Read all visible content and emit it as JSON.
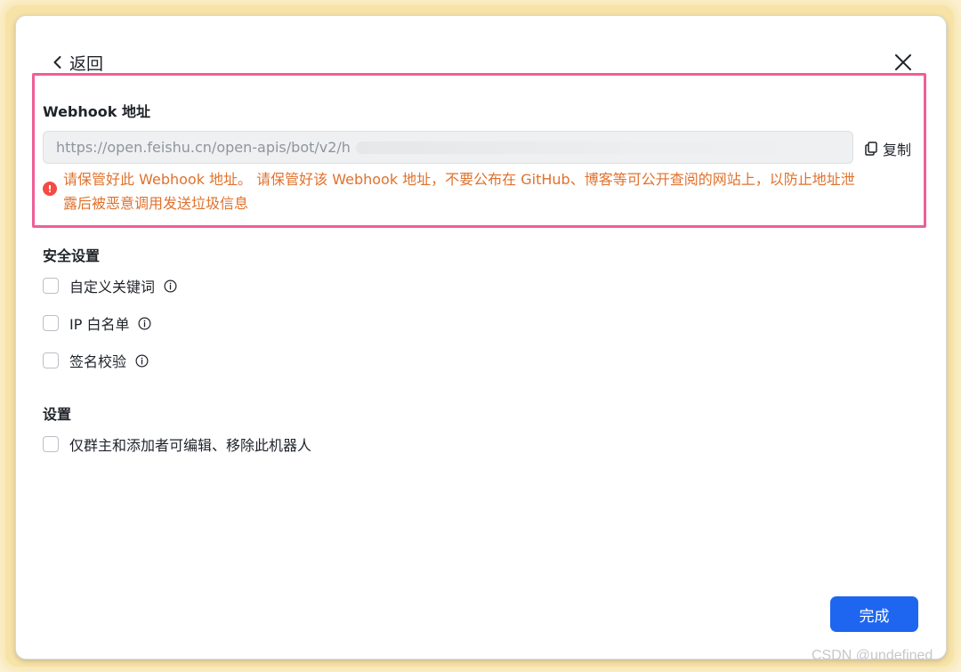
{
  "header": {
    "back_label": "返回"
  },
  "webhook": {
    "label": "Webhook 地址",
    "url_visible": "https://open.feishu.cn/open-apis/bot/v2/h",
    "copy_label": "复制",
    "warning_line1": "请保管好此 Webhook 地址。 请保管好该 Webhook 地址，不要公布在 GitHub、博客等可公开查阅的网站上，以防止地址泄",
    "warning_line2": "露后被恶意调用发送垃圾信息"
  },
  "security": {
    "title": "安全设置",
    "options": [
      {
        "label": "自定义关键词",
        "checked": false
      },
      {
        "label": "IP 白名单",
        "checked": false
      },
      {
        "label": "签名校验",
        "checked": false
      }
    ]
  },
  "settings": {
    "title": "设置",
    "options": [
      {
        "label": "仅群主和添加者可编辑、移除此机器人",
        "checked": false
      }
    ]
  },
  "footer": {
    "done_label": "完成"
  },
  "watermark": "CSDN @undefined",
  "colors": {
    "accent": "#1e66f0",
    "warning": "#e0712c",
    "highlight_border": "#ee5f97"
  }
}
